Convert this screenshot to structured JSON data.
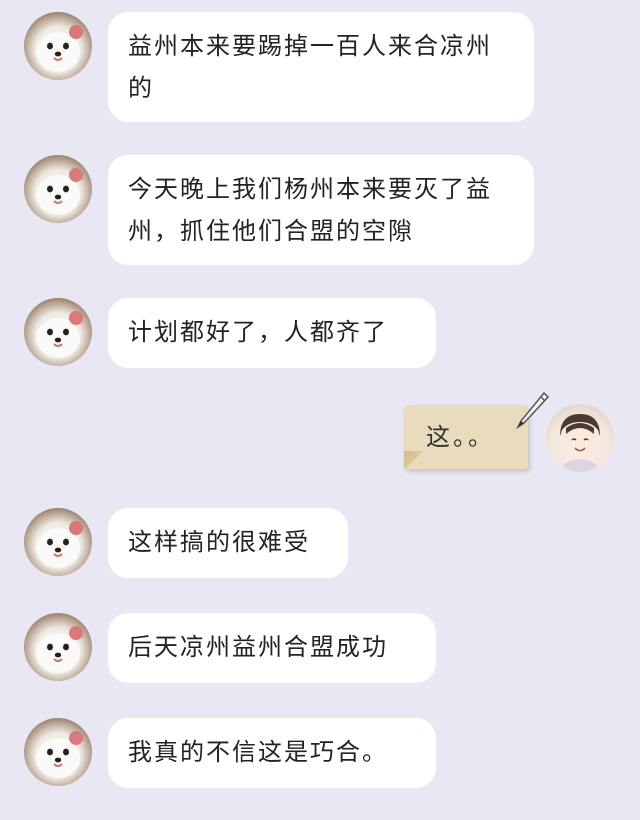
{
  "conversation": {
    "messages": [
      {
        "sender": "other",
        "text": "益州本来要踢掉一百人来合凉州的"
      },
      {
        "sender": "other",
        "text": "今天晚上我们杨州本来要灭了益州，抓住他们合盟的空隙"
      },
      {
        "sender": "other",
        "text": "计划都好了，人都齐了"
      },
      {
        "sender": "me",
        "text": "这。。"
      },
      {
        "sender": "other",
        "text": "这样搞的很难受"
      },
      {
        "sender": "other",
        "text": "后天凉州益州合盟成功"
      },
      {
        "sender": "other",
        "text": "我真的不信这是巧合。"
      }
    ]
  },
  "avatars": {
    "other": "white-dog-avatar",
    "me": "anime-boy-avatar"
  },
  "colors": {
    "background": "#e8e7f3",
    "bubble_other": "#ffffff",
    "bubble_me": "#e9dcbd"
  }
}
